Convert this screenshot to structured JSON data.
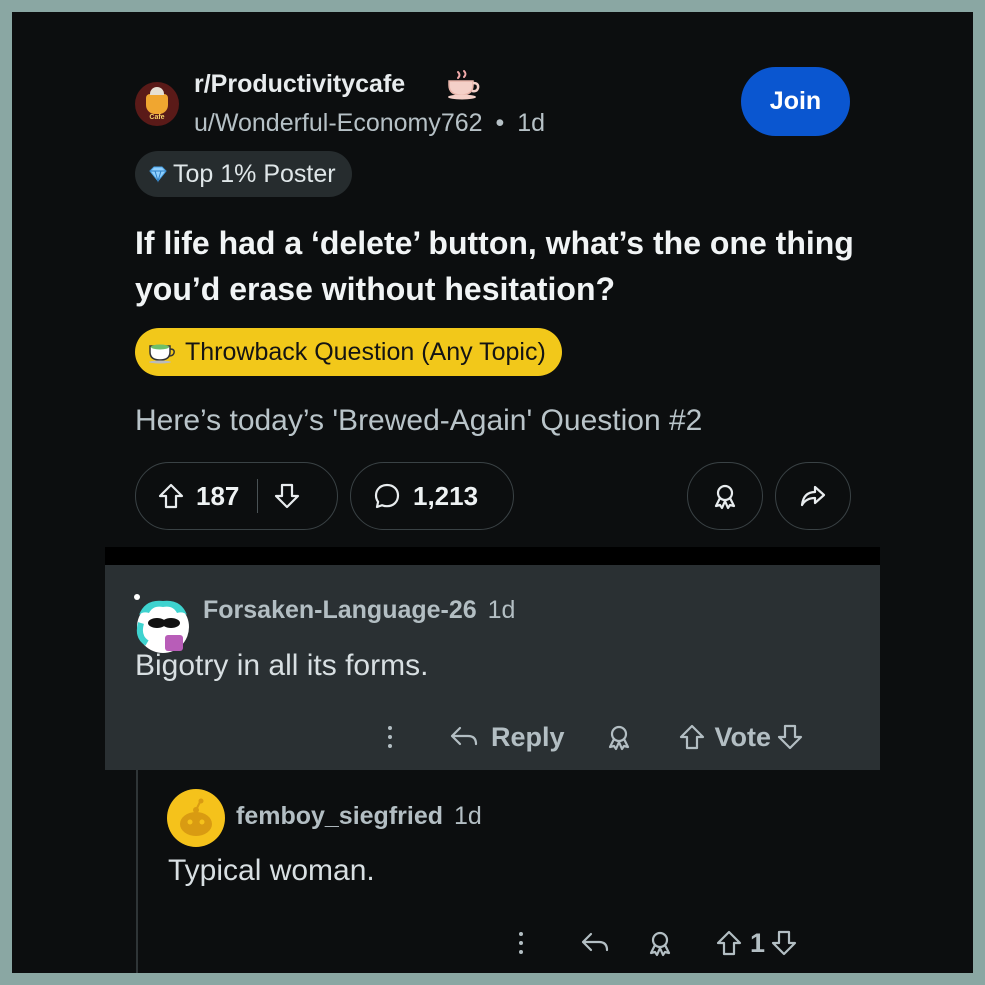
{
  "post": {
    "subreddit": "r/Productivitycafe",
    "subreddit_avatar_label": "Cafe",
    "author": "u/Wonderful-Economy762",
    "separator": "•",
    "age": "1d",
    "join_label": "Join",
    "badge": "Top 1% Poster",
    "title": "If life had a ‘delete’ button, what’s the one thing you’d erase without hesitation?",
    "flair": "Throwback Question (Any Topic)",
    "body": "Here’s today’s 'Brewed-Again' Question #2",
    "upvotes": "187",
    "comments": "1,213"
  },
  "comments": [
    {
      "author": "Forsaken-Language-26",
      "age": "1d",
      "text": "Bigotry in all its forms.",
      "reply_label": "Reply",
      "vote_label": "Vote"
    },
    {
      "author": "femboy_siegfried",
      "age": "1d",
      "text": "Typical woman.",
      "score": "1"
    }
  ],
  "colors": {
    "background": "#0c0e0f",
    "frame": "#8aa7a3",
    "join_button": "#0a56d0",
    "flair": "#f2c81a",
    "highlighted_comment": "#2a3033"
  },
  "icons": [
    "coffee-cup-icon",
    "diamond-icon",
    "upvote-icon",
    "downvote-icon",
    "comment-icon",
    "award-icon",
    "share-icon",
    "more-icon",
    "reply-icon"
  ]
}
